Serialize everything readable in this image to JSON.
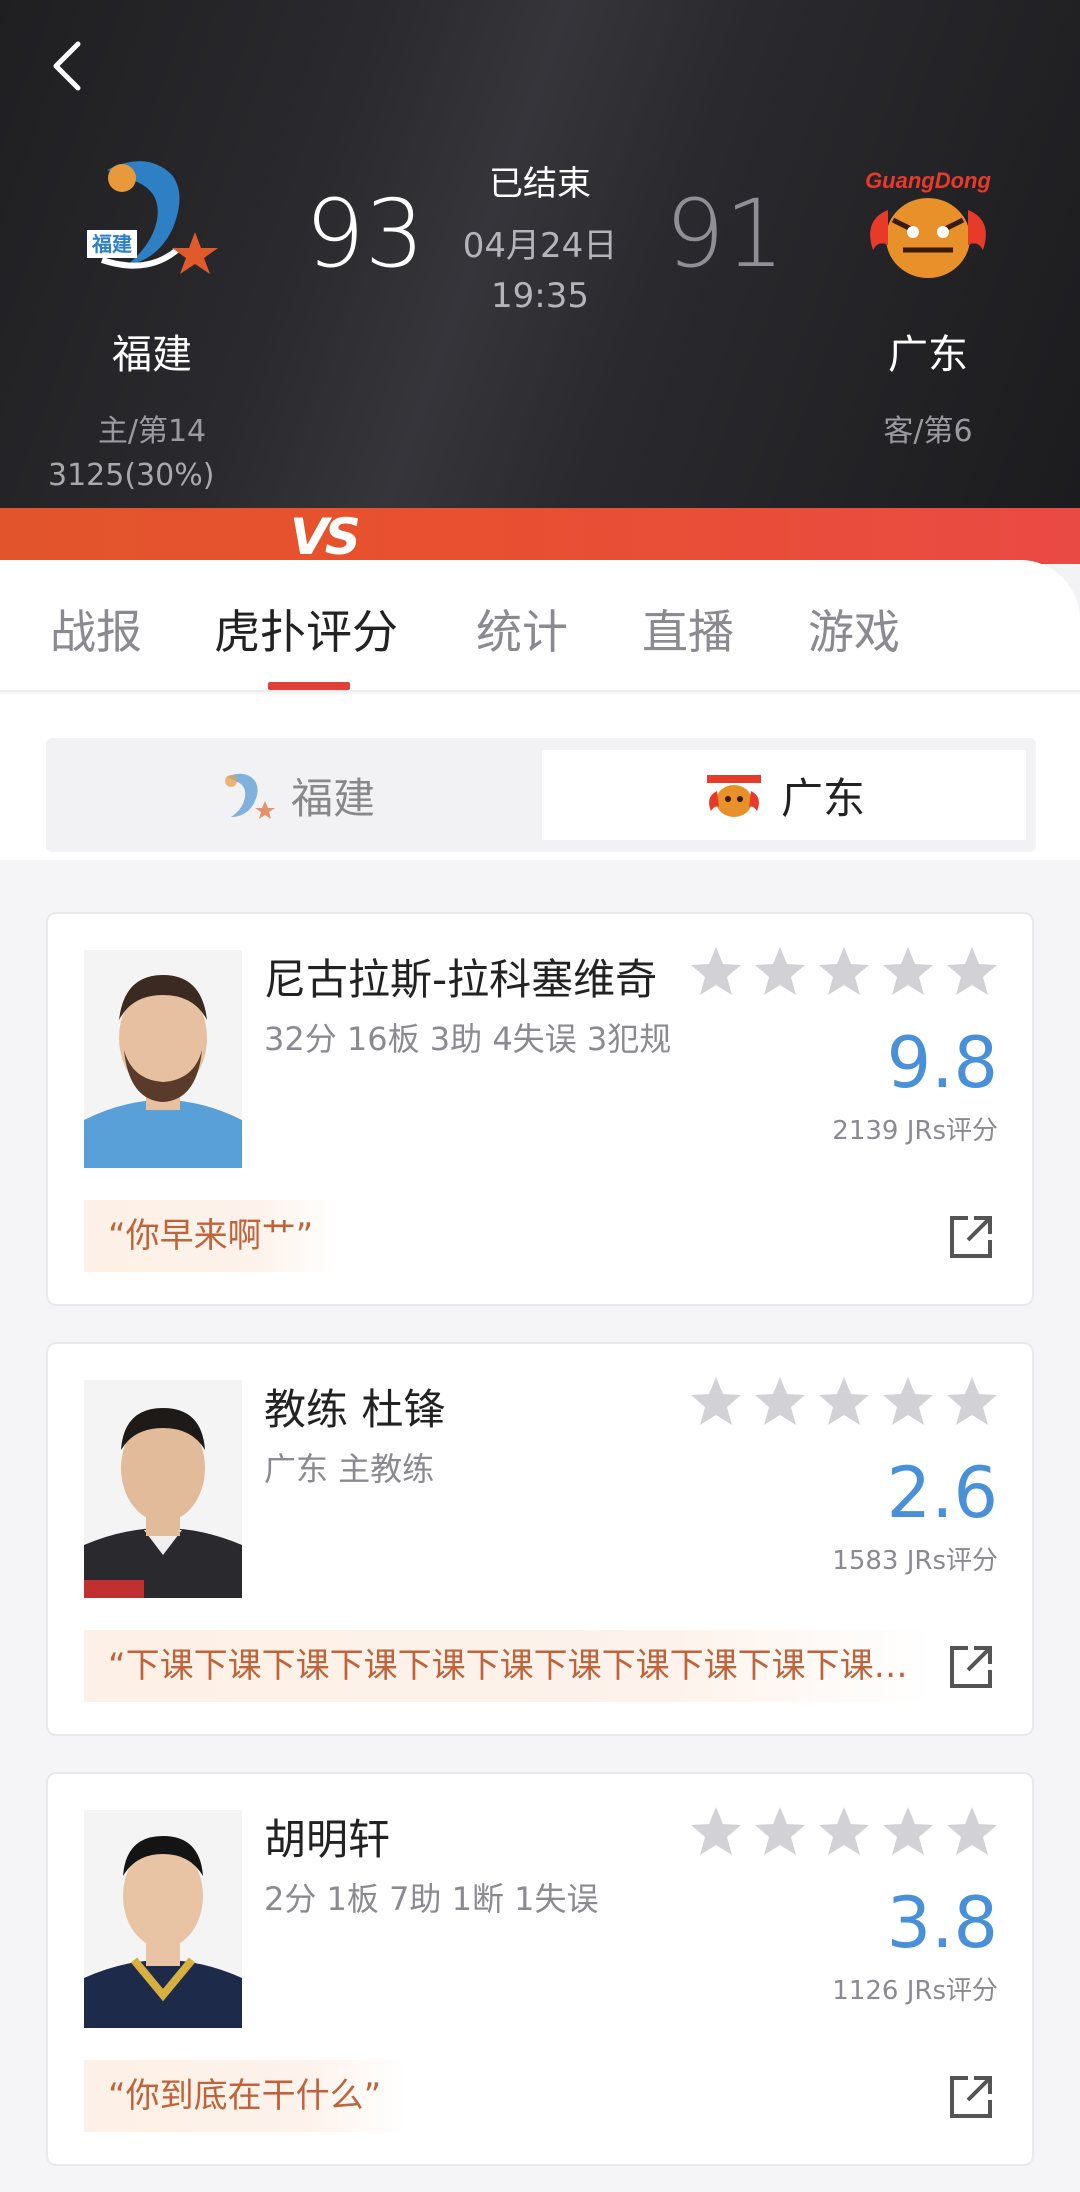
{
  "header": {
    "status": "已结束",
    "date": "04月24日",
    "time": "19:35",
    "home": {
      "name": "福建",
      "rank": "主/第14",
      "score": "93",
      "support": "3125(30%)"
    },
    "away": {
      "name": "广东",
      "rank": "客/第6",
      "score": "91"
    },
    "vs_label": "VS"
  },
  "tabs": [
    {
      "label": "战报"
    },
    {
      "label": "虎扑评分"
    },
    {
      "label": "统计"
    },
    {
      "label": "直播"
    },
    {
      "label": "游戏"
    }
  ],
  "active_tab": "虎扑评分",
  "team_switch": {
    "left": "福建",
    "right": "广东",
    "selected": "广东"
  },
  "players": [
    {
      "name": "尼古拉斯-拉科塞维奇",
      "stats": "32分 16板 3助 4失误 3犯规",
      "rating": "9.8",
      "votes": "2139 JRs评分",
      "quote": "“你早来啊艹”"
    },
    {
      "name": "教练 杜锋",
      "stats": "广东 主教练",
      "rating": "2.6",
      "votes": "1583 JRs评分",
      "quote": "“下课下课下课下课下课下课下课下课下课下课下课…"
    },
    {
      "name": "胡明轩",
      "stats": "2分 1板 7助 1断 1失误",
      "rating": "3.8",
      "votes": "1126 JRs评分",
      "quote": "“你到底在干什么”"
    }
  ],
  "colors": {
    "accent": "#e0403a",
    "rating": "#4a90d9",
    "quote": "#c0623a",
    "star": "#d2d2d6"
  },
  "icons": [
    "back-arrow-icon",
    "star-icon",
    "share-icon"
  ]
}
